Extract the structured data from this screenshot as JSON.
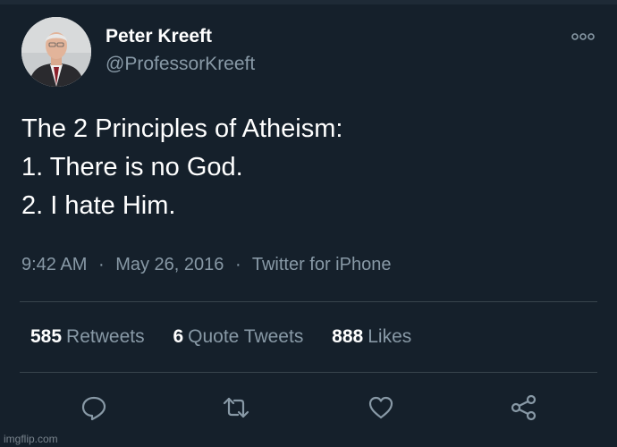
{
  "author": {
    "name": "Peter Kreeft",
    "handle": "@ProfessorKreeft"
  },
  "tweet": {
    "lines": [
      "The 2 Principles of Atheism:",
      "1. There is no God.",
      "2. I hate Him."
    ],
    "time": "9:42 AM",
    "date": "May 26, 2016",
    "source": "Twitter for iPhone",
    "separator": "·"
  },
  "stats": {
    "retweets": {
      "count": "585",
      "label": "Retweets"
    },
    "quotes": {
      "count": "6",
      "label": "Quote Tweets"
    },
    "likes": {
      "count": "888",
      "label": "Likes"
    }
  },
  "actions": [
    "reply-icon",
    "retweet-icon",
    "like-icon",
    "share-icon"
  ],
  "watermark": "imgflip.com",
  "colors": {
    "background": "#15202b",
    "text": "#ffffff",
    "secondary": "#8899a6",
    "divider": "#38444d"
  }
}
